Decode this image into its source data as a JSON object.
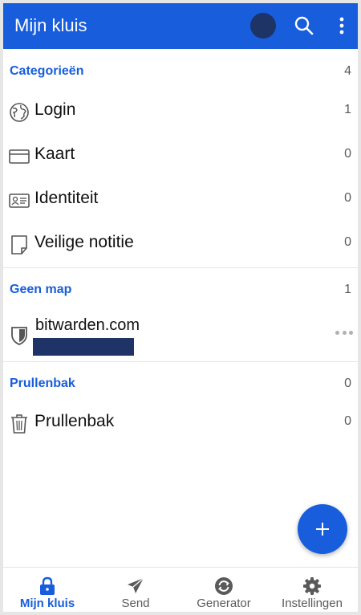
{
  "colors": {
    "primary": "#175ddc",
    "avatar": "#1e3366",
    "text": "#111111",
    "muted": "#5a5a5a"
  },
  "appbar": {
    "title": "Mijn kluis",
    "search_icon": "search-icon",
    "menu_icon": "more-vertical-icon"
  },
  "sections": {
    "categories": {
      "title": "Categorieën",
      "count": "4",
      "items": [
        {
          "label": "Login",
          "count": "1",
          "icon": "globe-icon"
        },
        {
          "label": "Kaart",
          "count": "0",
          "icon": "credit-card-icon"
        },
        {
          "label": "Identiteit",
          "count": "0",
          "icon": "id-card-icon"
        },
        {
          "label": "Veilige notitie",
          "count": "0",
          "icon": "note-icon"
        }
      ]
    },
    "no_folder": {
      "title": "Geen map",
      "count": "1",
      "items": [
        {
          "title": "bitwarden.com",
          "icon": "shield-icon"
        }
      ]
    },
    "trash": {
      "title": "Prullenbak",
      "count": "0",
      "items": [
        {
          "label": "Prullenbak",
          "count": "0",
          "icon": "trash-icon"
        }
      ]
    }
  },
  "fab": {
    "icon": "plus-icon"
  },
  "bottom_nav": [
    {
      "label": "Mijn kluis",
      "icon": "lock-icon",
      "active": true
    },
    {
      "label": "Send",
      "icon": "send-icon",
      "active": false
    },
    {
      "label": "Generator",
      "icon": "refresh-icon",
      "active": false
    },
    {
      "label": "Instellingen",
      "icon": "gear-icon",
      "active": false
    }
  ]
}
